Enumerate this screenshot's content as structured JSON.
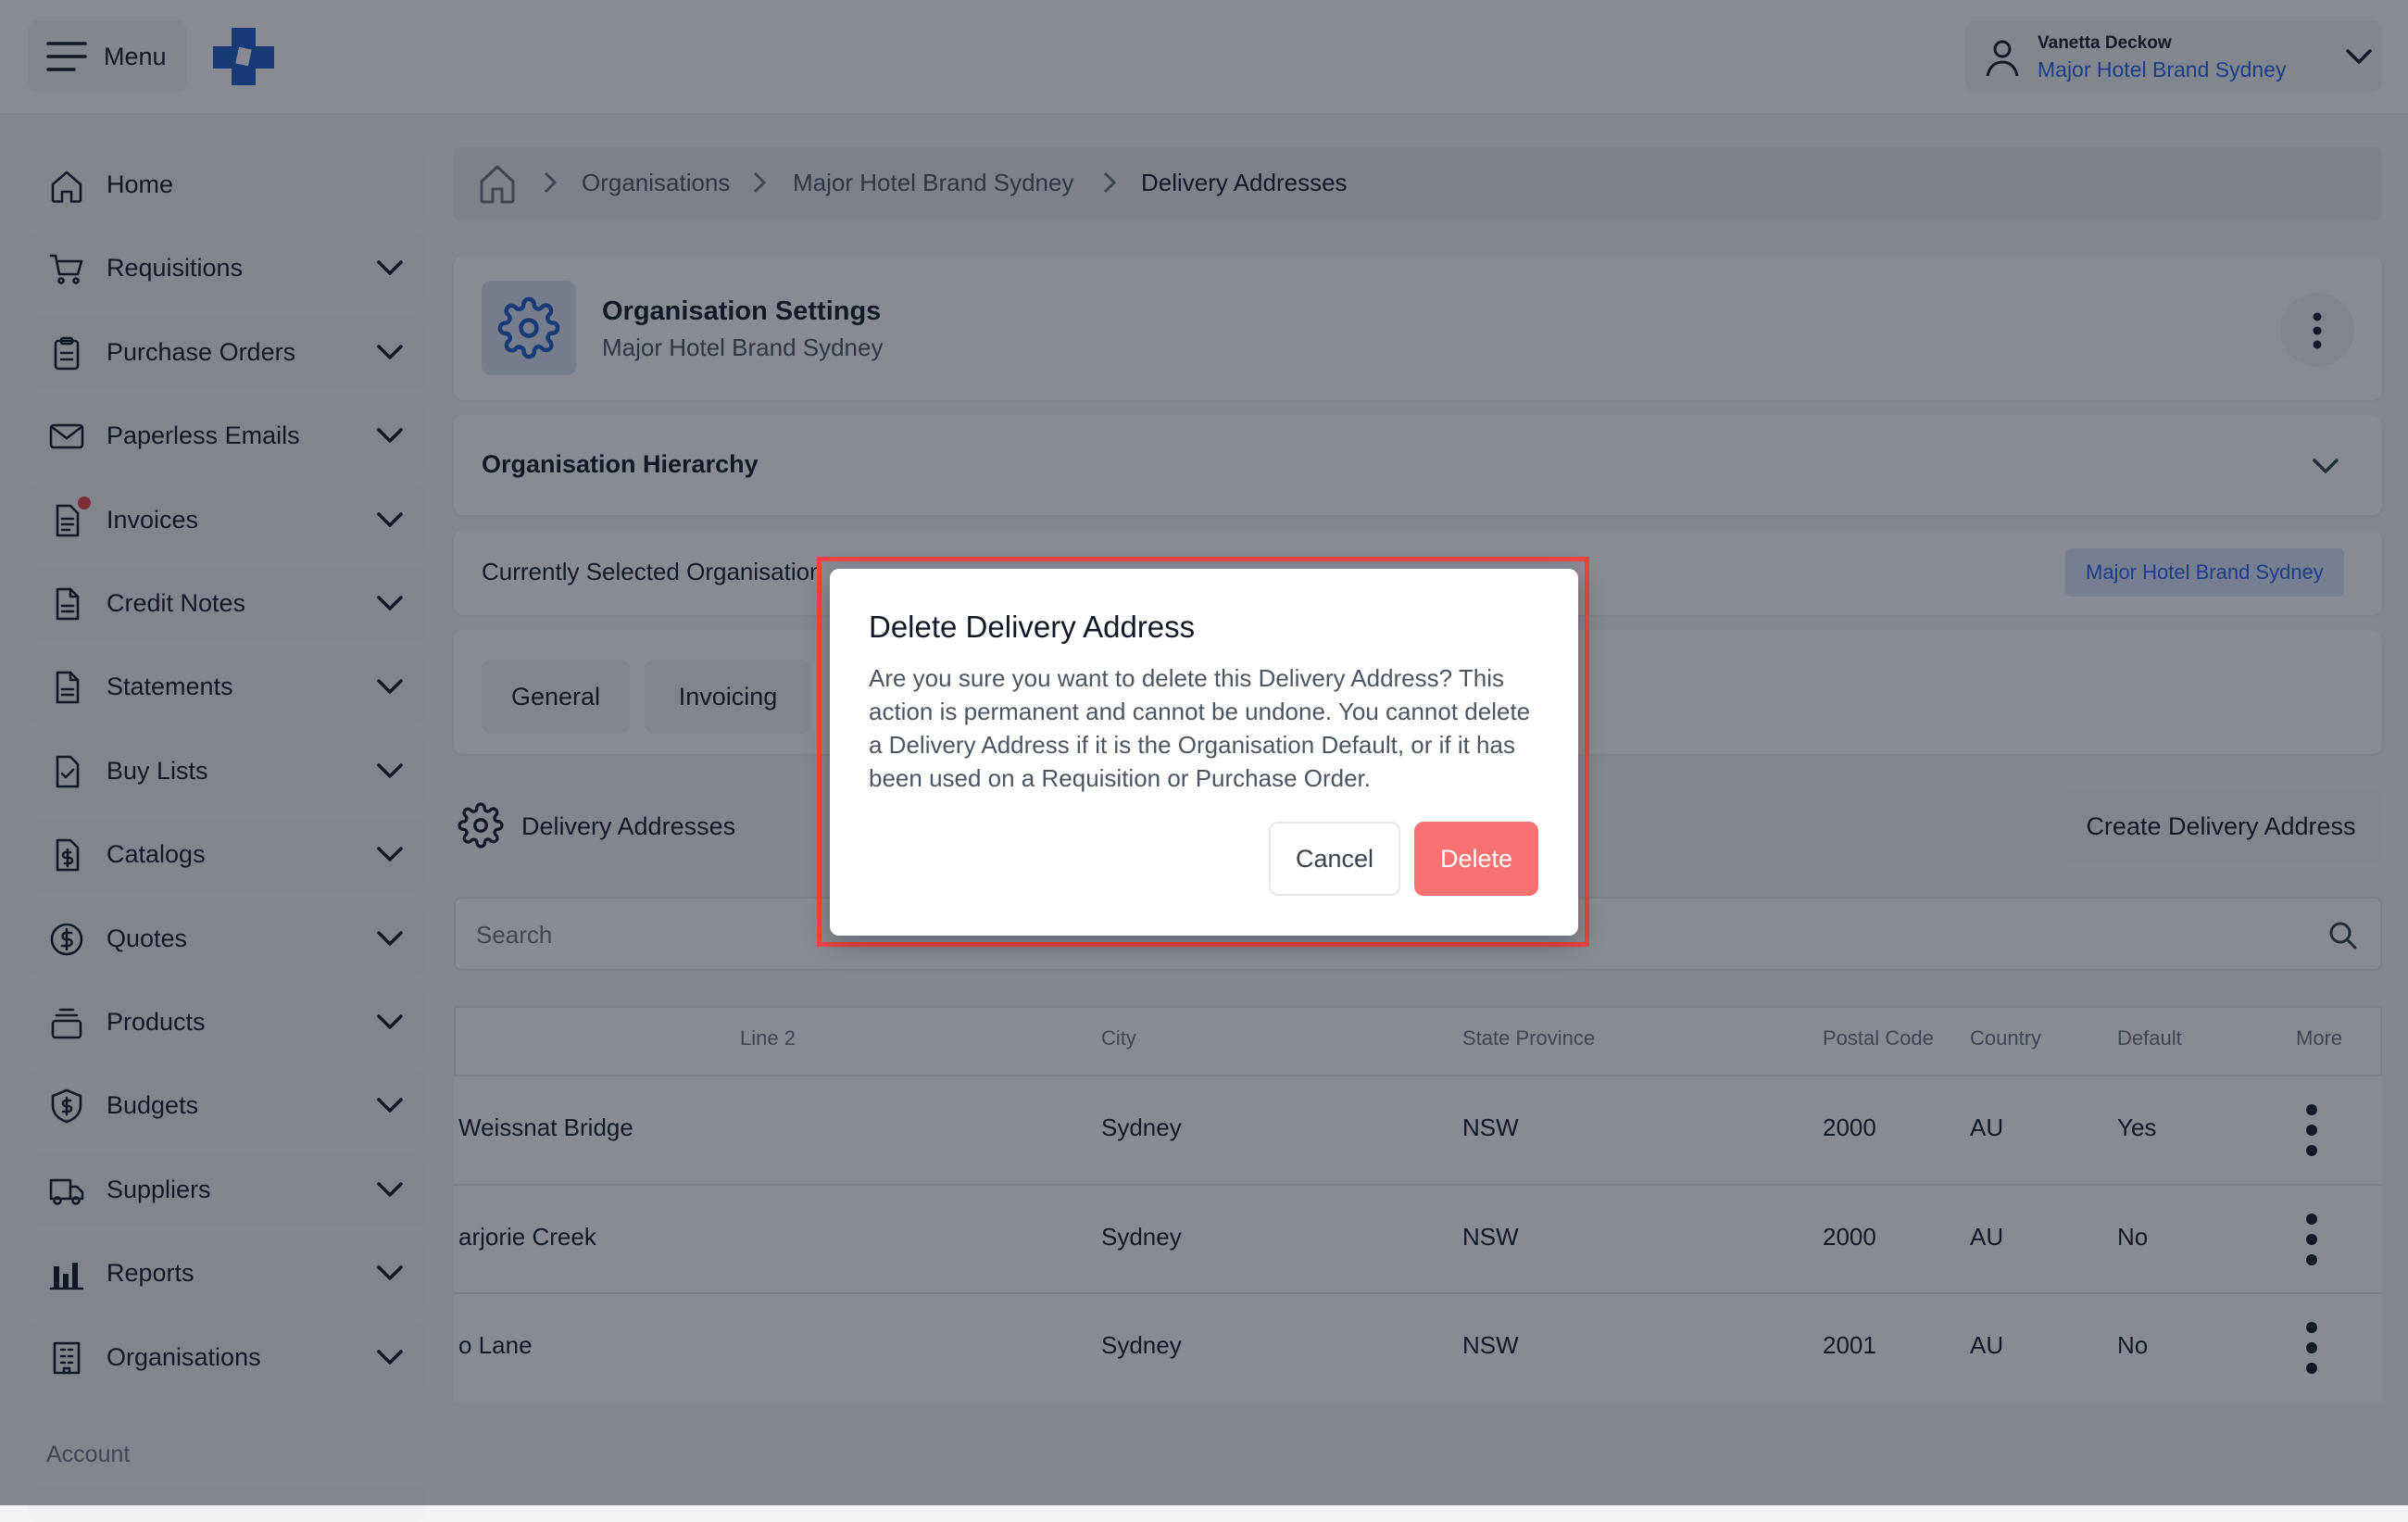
{
  "header": {
    "menu_label": "Menu",
    "user_name": "Vanetta Deckow",
    "user_org": "Major Hotel Brand Sydney"
  },
  "sidebar": {
    "items": [
      {
        "label": "Home",
        "icon": "home-icon"
      },
      {
        "label": "Requisitions",
        "icon": "cart-icon"
      },
      {
        "label": "Purchase Orders",
        "icon": "clipboard-icon"
      },
      {
        "label": "Paperless Emails",
        "icon": "mail-icon"
      },
      {
        "label": "Invoices",
        "icon": "invoice-icon"
      },
      {
        "label": "Credit Notes",
        "icon": "document-icon"
      },
      {
        "label": "Statements",
        "icon": "document-icon"
      },
      {
        "label": "Buy Lists",
        "icon": "checklist-icon"
      },
      {
        "label": "Catalogs",
        "icon": "catalog-icon"
      },
      {
        "label": "Quotes",
        "icon": "dollar-circle-icon"
      },
      {
        "label": "Products",
        "icon": "stack-icon"
      },
      {
        "label": "Budgets",
        "icon": "shield-dollar-icon"
      },
      {
        "label": "Suppliers",
        "icon": "truck-icon"
      },
      {
        "label": "Reports",
        "icon": "bar-chart-icon"
      },
      {
        "label": "Organisations",
        "icon": "building-icon"
      }
    ],
    "account_label": "Account"
  },
  "breadcrumb": {
    "items": [
      "Organisations",
      "Major Hotel Brand Sydney",
      "Delivery Addresses"
    ]
  },
  "settings_card": {
    "title": "Organisation Settings",
    "subtitle": "Major Hotel Brand Sydney"
  },
  "hierarchy": {
    "title": "Organisation Hierarchy"
  },
  "selected_org": {
    "label": "Currently Selected Organisation",
    "value": "Major Hotel Brand Sydney"
  },
  "tabs": [
    "General",
    "Invoicing"
  ],
  "section": {
    "title": "Delivery Addresses",
    "create_button": "Create Delivery Address"
  },
  "search": {
    "placeholder": "Search"
  },
  "table": {
    "columns": [
      "Line 2",
      "City",
      "State Province",
      "Postal Code",
      "Country",
      "Default",
      "More"
    ],
    "rows": [
      {
        "line1": "Weissnat Bridge",
        "line2": "",
        "city": "Sydney",
        "state": "NSW",
        "postal": "2000",
        "country": "AU",
        "default": "Yes"
      },
      {
        "line1": "arjorie Creek",
        "line2": "",
        "city": "Sydney",
        "state": "NSW",
        "postal": "2000",
        "country": "AU",
        "default": "No"
      },
      {
        "line1": "o Lane",
        "line2": "",
        "city": "Sydney",
        "state": "NSW",
        "postal": "2001",
        "country": "AU",
        "default": "No"
      }
    ]
  },
  "modal": {
    "title": "Delete Delivery Address",
    "body": "Are you sure you want to delete this Delivery Address? This action is permanent and cannot be undone. You cannot delete a Delivery Address if it is the Organisation Default, or if it has been used on a Requisition or Purchase Order.",
    "cancel_label": "Cancel",
    "delete_label": "Delete"
  },
  "colors": {
    "brand_blue": "#1d5fc4",
    "link_blue": "#2563eb",
    "danger": "#f87171",
    "highlight": "#ef4444"
  }
}
